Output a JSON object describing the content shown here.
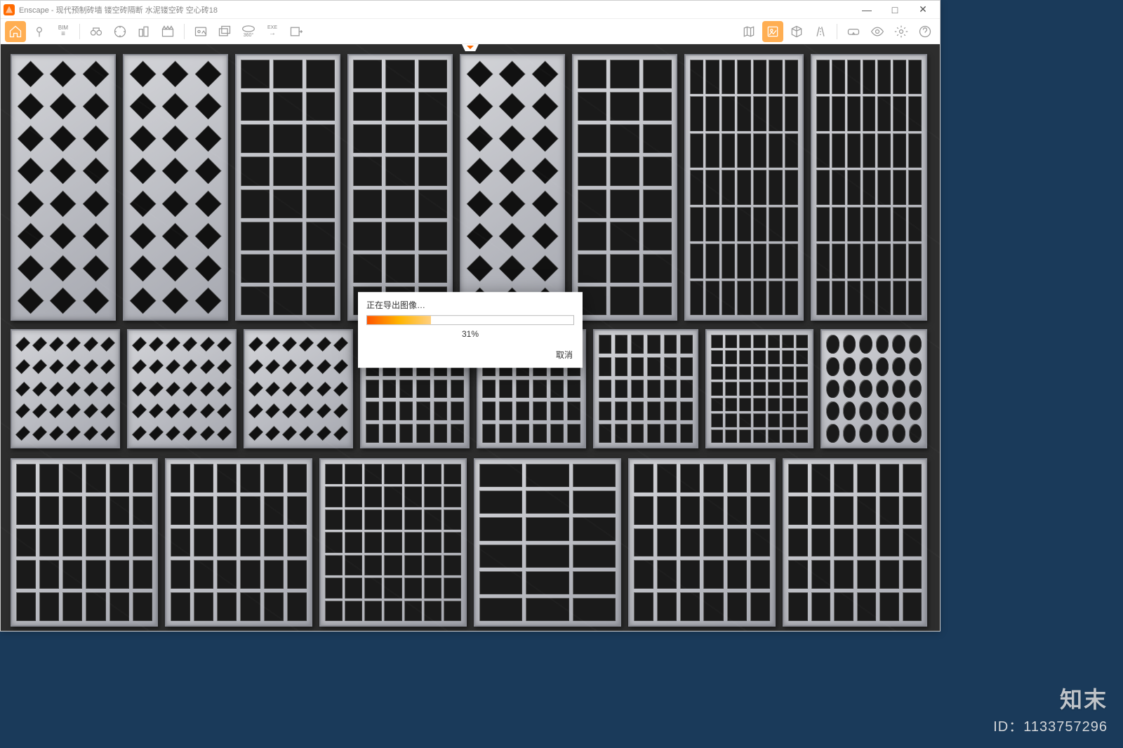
{
  "app": {
    "name": "Enscape",
    "title": "Enscape - 现代预制砖墙 镂空砖隔断 水泥镂空砖 空心砖18"
  },
  "window_controls": {
    "minimize": "—",
    "maximize": "□",
    "close": "✕"
  },
  "toolbar": {
    "left": [
      {
        "name": "home-icon",
        "active": true
      },
      {
        "name": "location-pin-icon",
        "active": false
      },
      {
        "name": "bim-menu-icon",
        "label": "BIM",
        "active": false
      },
      {
        "name": "binoculars-icon",
        "active": false
      },
      {
        "name": "compass-icon",
        "active": false
      },
      {
        "name": "buildings-icon",
        "active": false
      },
      {
        "name": "clapperboard-icon",
        "active": false
      },
      {
        "name": "screenshot-icon",
        "active": false
      },
      {
        "name": "batch-render-icon",
        "active": false
      },
      {
        "name": "panorama-360-icon",
        "label": "360°",
        "active": false
      },
      {
        "name": "export-exe-icon",
        "label": "EXE",
        "active": false
      },
      {
        "name": "export-web-icon",
        "active": false
      }
    ],
    "right": [
      {
        "name": "map-icon",
        "active": false
      },
      {
        "name": "asset-library-icon",
        "active": true
      },
      {
        "name": "cube-icon",
        "active": false
      },
      {
        "name": "road-icon",
        "active": false
      },
      {
        "name": "vr-headset-icon",
        "active": false
      },
      {
        "name": "eye-icon",
        "active": false
      },
      {
        "name": "settings-gear-icon",
        "active": false
      },
      {
        "name": "help-icon",
        "active": false
      }
    ]
  },
  "dialog": {
    "title": "正在导出图像…",
    "progress_percent": 31,
    "progress_label": "31%",
    "cancel_label": "取消"
  },
  "watermark": {
    "brand": "知末",
    "id_label": "ID：1133757296"
  },
  "colors": {
    "accent": "#ff7a00",
    "viewport_bg": "#2d2d2d",
    "panel_light": "#d3d4d8",
    "panel_dark": "#8a8c94"
  }
}
